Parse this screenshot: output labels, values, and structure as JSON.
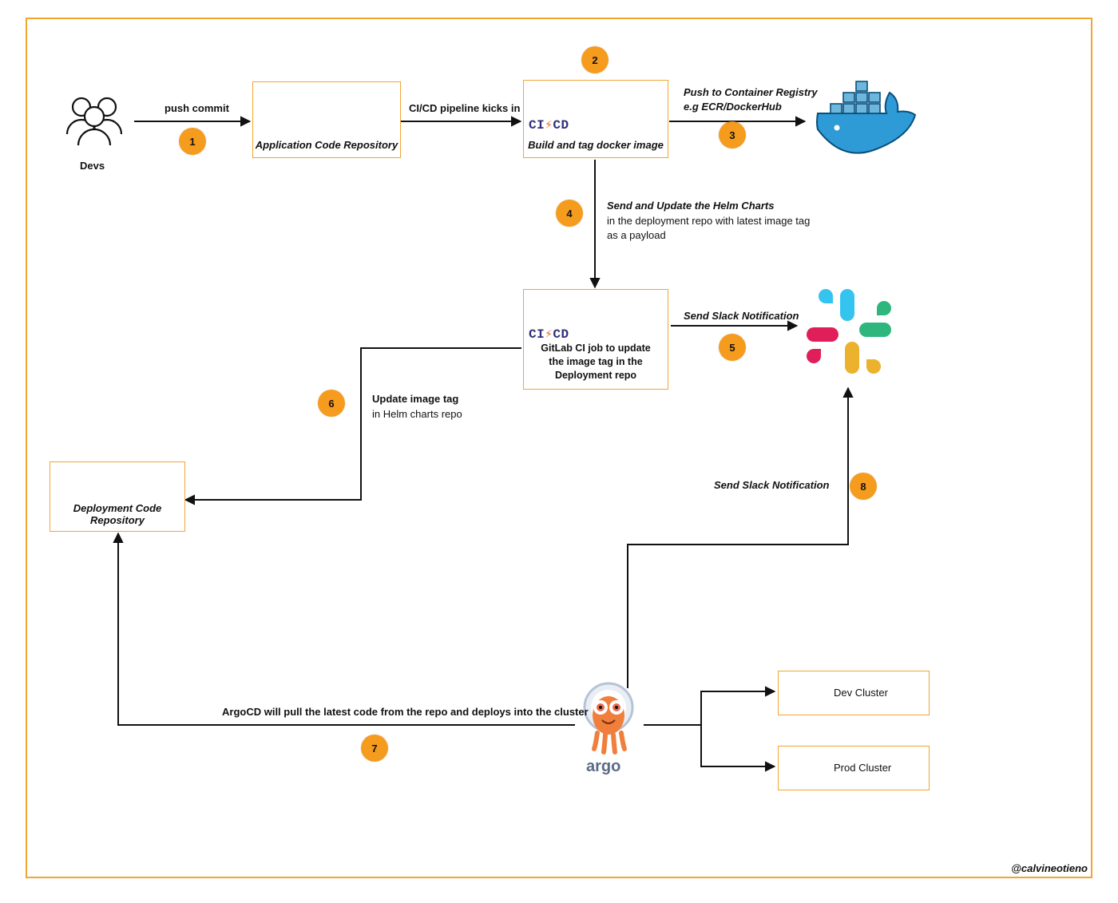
{
  "nodes": {
    "devs_label": "Devs",
    "app_repo": "Application Code Repository",
    "cicd_build": "Build and tag docker image",
    "cicd_update": "GitLab CI job to update\nthe image tag in the\nDeployment repo",
    "deploy_repo": "Deployment Code Repository",
    "dev_cluster": "Dev Cluster",
    "prod_cluster": "Prod Cluster",
    "argo_label": "argo"
  },
  "steps": {
    "s1": "1",
    "s2": "2",
    "s3": "3",
    "s4": "4",
    "s5": "5",
    "s6": "6",
    "s7": "7",
    "s8": "8"
  },
  "edges": {
    "push_commit": "push commit",
    "pipeline_kicks": "CI/CD pipeline kicks in",
    "push_registry_l1": "Push to Container Registry",
    "push_registry_l2": "e.g ECR/DockerHub",
    "helm_update_l1": "Send and Update the Helm Charts",
    "helm_update_l2": "in the deployment repo with latest image tag",
    "helm_update_l3": "as a payload",
    "slack5": "Send Slack Notification",
    "slack8": "Send Slack Notification",
    "update_tag_l1": "Update image tag",
    "update_tag_l2": "in Helm charts repo",
    "argo_pull": "ArgoCD will pull the latest code from the repo and deploys into the cluster"
  },
  "credit": "@calvineotieno",
  "cicd_text": {
    "left": "CI",
    "slash": "⚡",
    "right": "CD"
  }
}
